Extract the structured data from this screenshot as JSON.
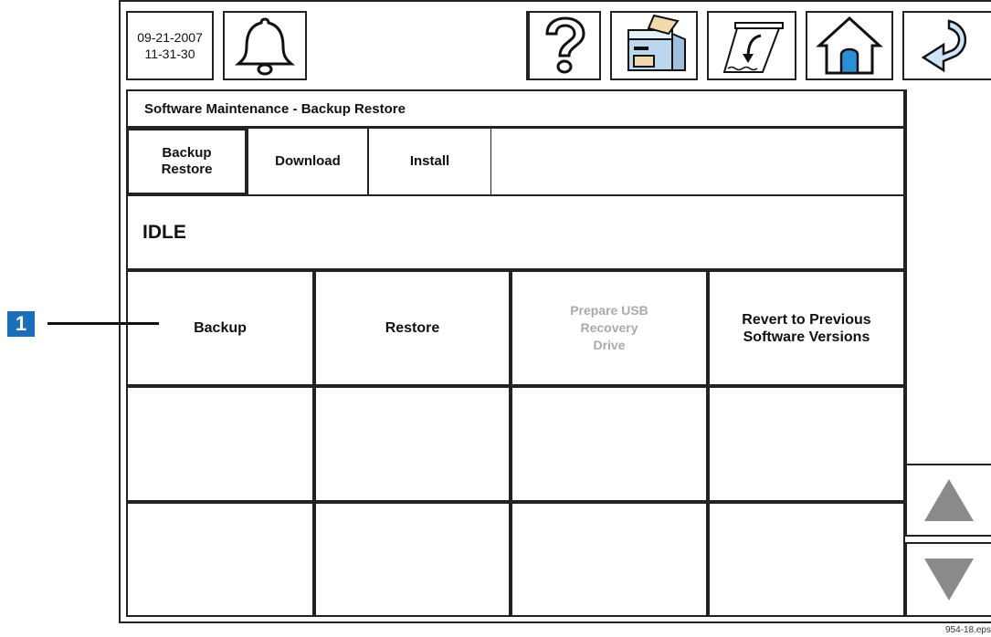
{
  "header": {
    "date": "09-21-2007",
    "time": "11-31-30",
    "message": ""
  },
  "icons": [
    "bell-icon",
    "help-icon",
    "printer-icon",
    "paper-feed-icon",
    "home-icon",
    "back-arrow-icon"
  ],
  "page_title": "Software Maintenance - Backup Restore",
  "tabs": [
    {
      "label": "Backup\nRestore",
      "active": true
    },
    {
      "label": "Download",
      "active": false
    },
    {
      "label": "Install",
      "active": false
    }
  ],
  "status": "IDLE",
  "buttons": [
    {
      "label": "Backup",
      "enabled": true
    },
    {
      "label": "Restore",
      "enabled": true
    },
    {
      "label": "Prepare USB\nRecovery\nDrive",
      "enabled": false
    },
    {
      "label": "Revert to Previous\nSoftware Versions",
      "enabled": true
    }
  ],
  "callout": {
    "number": "1"
  },
  "figure_id": "954-18.eps",
  "colors": {
    "callout": "#1a6fb8",
    "icon_blue": "#2a8fd6",
    "arrow_gray": "#8a8a8a"
  }
}
